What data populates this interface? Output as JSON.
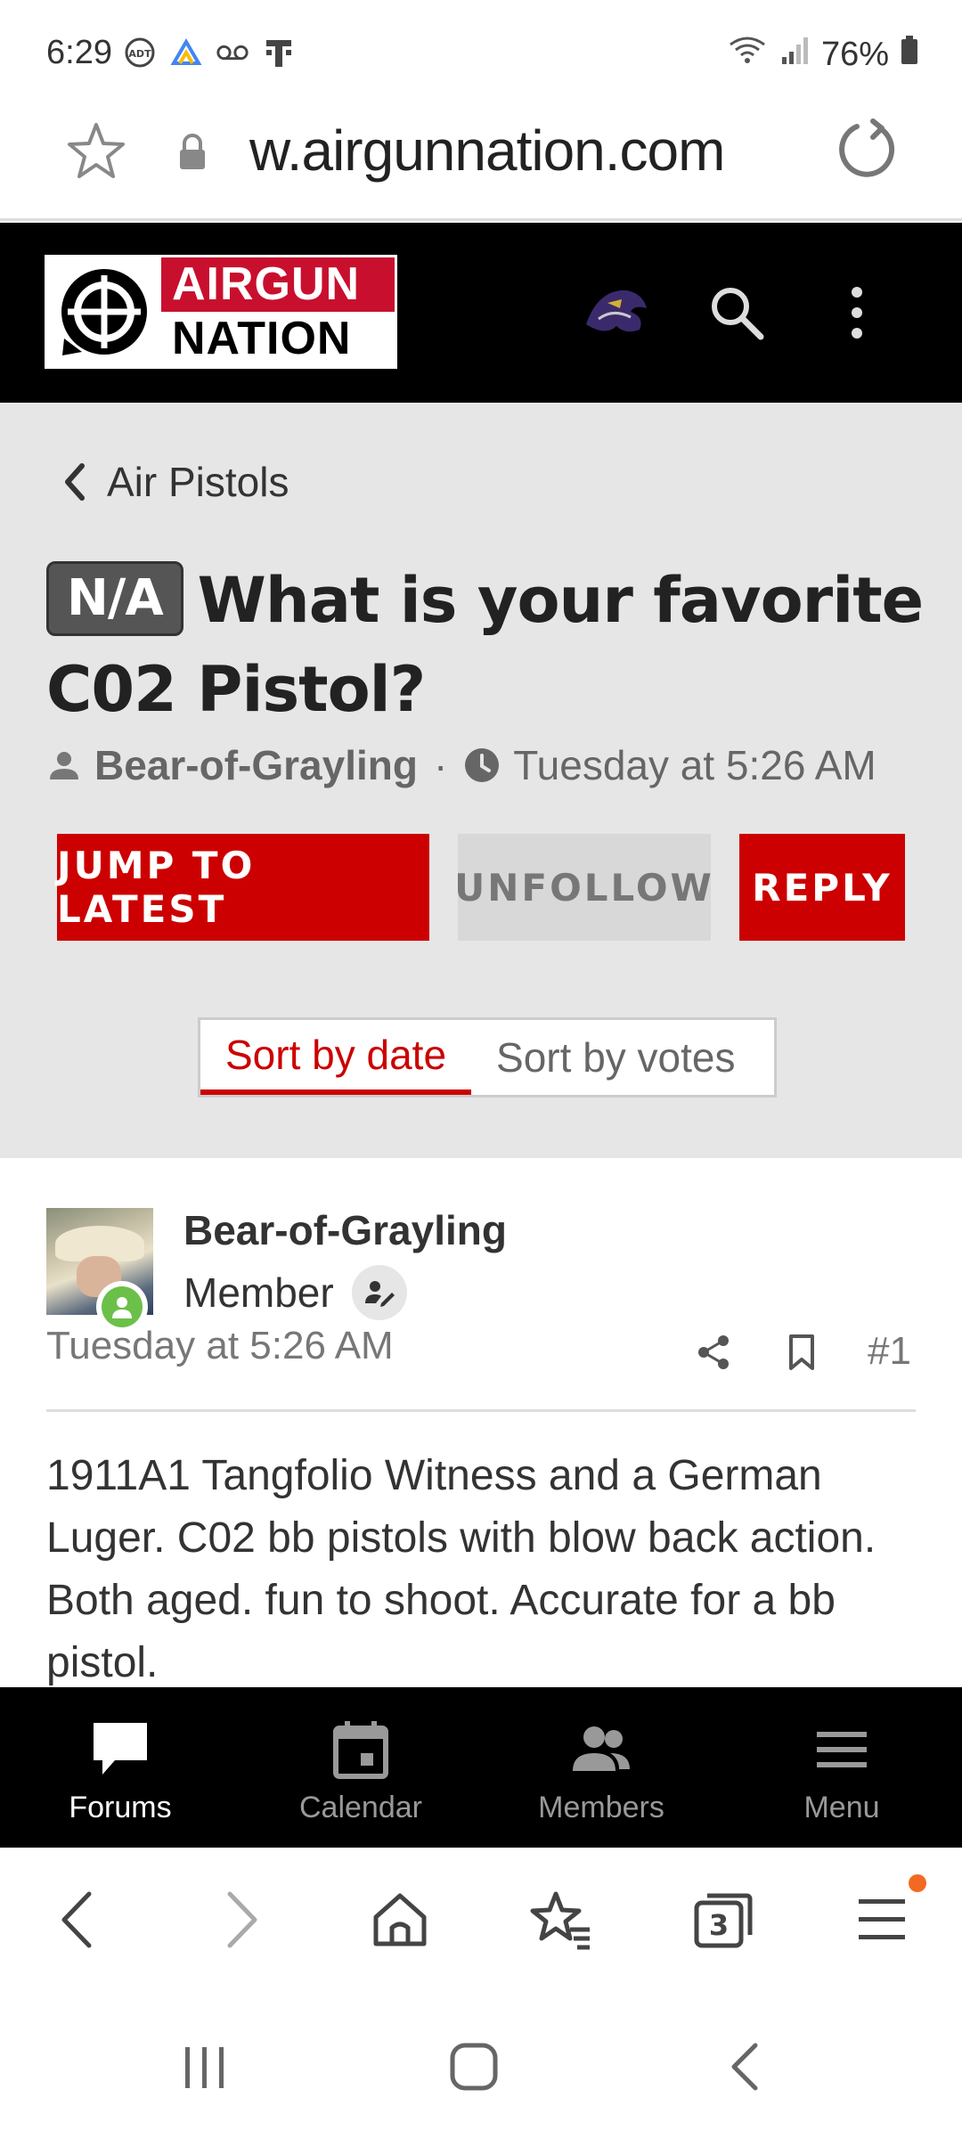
{
  "status_bar": {
    "time": "6:29",
    "battery": "76%"
  },
  "url_bar": {
    "url_text": "w.airgunnation.com"
  },
  "site_header": {
    "logo_top": "AIRGUN",
    "logo_bottom": "NATION"
  },
  "thread": {
    "breadcrumb": "Air Pistols",
    "prefix": "N/A",
    "title": "What is your favorite C02 Pistol?",
    "author": "Bear-of-Grayling",
    "separator": "·",
    "time": "Tuesday at 5:26 AM",
    "buttons": {
      "jump_latest": "JUMP TO LATEST",
      "unfollow": "UNFOLLOW",
      "reply": "REPLY"
    },
    "sort": {
      "by_date": "Sort by date",
      "by_votes": "Sort by votes",
      "active": "by_date"
    }
  },
  "post": {
    "author": "Bear-of-Grayling",
    "role": "Member",
    "time": "Tuesday at 5:26 AM",
    "number": "#1",
    "body": "1911A1 Tangfolio Witness and a German Luger. C02 bb pistols with blow back action. Both aged. fun to shoot. Accurate for a bb pistol."
  },
  "forum_nav": {
    "items": [
      {
        "label": "Forums",
        "icon": "chat-bubble-icon",
        "active": true
      },
      {
        "label": "Calendar",
        "icon": "calendar-icon",
        "active": false
      },
      {
        "label": "Members",
        "icon": "members-icon",
        "active": false
      },
      {
        "label": "Menu",
        "icon": "hamburger-icon",
        "active": false
      }
    ]
  },
  "colors": {
    "brand_red": "#cc0000",
    "header_bg": "#000000",
    "thread_bg": "#e6e6e6",
    "online_green": "#6cc04a",
    "notification_orange": "#f26a21"
  }
}
